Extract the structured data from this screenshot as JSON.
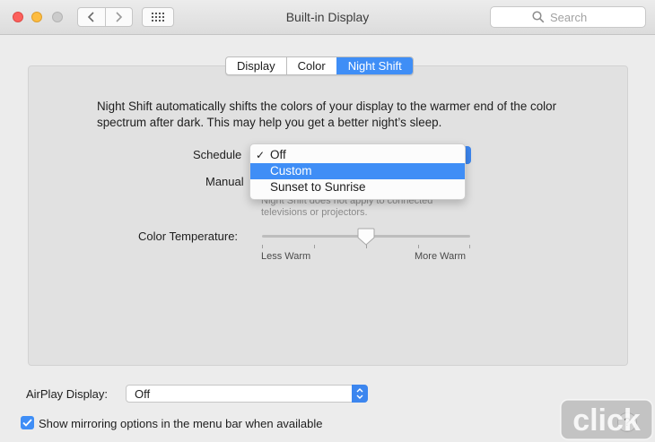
{
  "window": {
    "title": "Built-in Display"
  },
  "toolbar": {
    "search_placeholder": "Search",
    "icons": [
      "back-icon",
      "forward-icon",
      "grid-icon",
      "search-icon"
    ]
  },
  "tabs": [
    {
      "label": "Display",
      "selected": false
    },
    {
      "label": "Color",
      "selected": false
    },
    {
      "label": "Night Shift",
      "selected": true
    }
  ],
  "night_shift": {
    "description": "Night Shift automatically shifts the colors of your display to the warmer end of the color spectrum after dark. This may help you get a better night’s sleep.",
    "schedule_label": "Schedule",
    "schedule_options": [
      {
        "label": "Off",
        "checked": true,
        "highlighted": false
      },
      {
        "label": "Custom",
        "checked": false,
        "highlighted": true
      },
      {
        "label": "Sunset to Sunrise",
        "checked": false,
        "highlighted": false
      }
    ],
    "manual_label": "Manual",
    "note": "Night Shift does not apply to connected televisions or projectors.",
    "color_temperature_label": "Color Temperature:",
    "slider_min_label": "Less Warm",
    "slider_max_label": "More Warm",
    "slider_value": 0.5
  },
  "airplay": {
    "label": "AirPlay Display:",
    "value": "Off"
  },
  "mirroring": {
    "label": "Show mirroring options in the menu bar when available",
    "checked": true
  },
  "watermark": {
    "text": "click"
  },
  "colors": {
    "accent": "#3f8ef6",
    "close": "#fc605c",
    "minimize": "#fdbc40",
    "zoom": "#cbcbcb"
  }
}
